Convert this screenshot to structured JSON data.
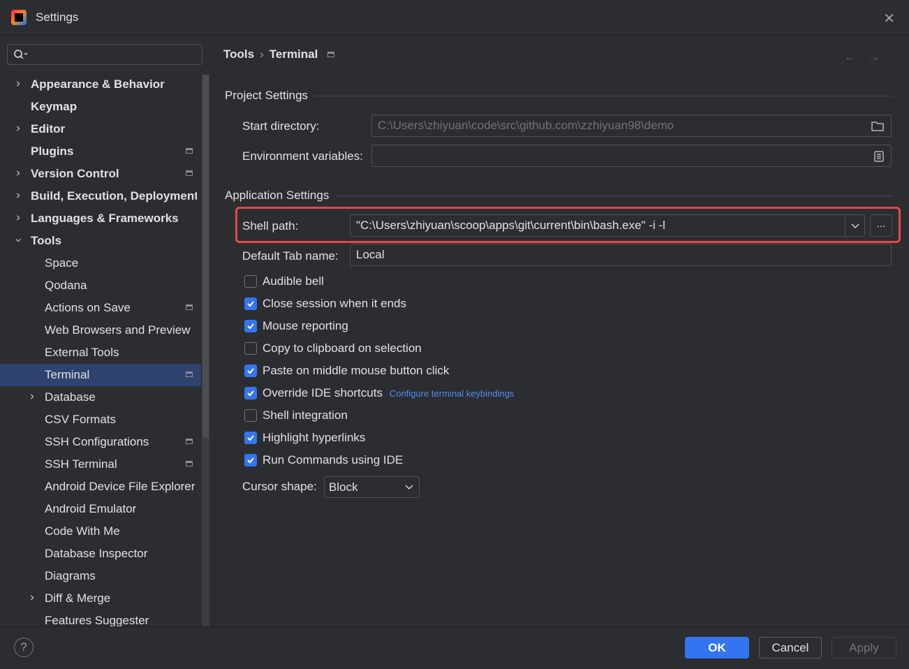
{
  "window": {
    "title": "Settings"
  },
  "search": {
    "placeholder": ""
  },
  "sidebar": {
    "items": [
      {
        "label": "Appearance & Behavior",
        "bold": true,
        "level": 0,
        "chevron": "right",
        "mark": false
      },
      {
        "label": "Keymap",
        "bold": true,
        "level": 0,
        "chevron": "none",
        "mark": false
      },
      {
        "label": "Editor",
        "bold": true,
        "level": 0,
        "chevron": "right",
        "mark": false
      },
      {
        "label": "Plugins",
        "bold": true,
        "level": 0,
        "chevron": "none",
        "mark": true
      },
      {
        "label": "Version Control",
        "bold": true,
        "level": 0,
        "chevron": "right",
        "mark": true
      },
      {
        "label": "Build, Execution, Deployment",
        "bold": true,
        "level": 0,
        "chevron": "right",
        "mark": false
      },
      {
        "label": "Languages & Frameworks",
        "bold": true,
        "level": 0,
        "chevron": "right",
        "mark": false
      },
      {
        "label": "Tools",
        "bold": true,
        "level": 0,
        "chevron": "down",
        "mark": false
      },
      {
        "label": "Space",
        "bold": false,
        "level": 1,
        "chevron": "none",
        "mark": false
      },
      {
        "label": "Qodana",
        "bold": false,
        "level": 1,
        "chevron": "none",
        "mark": false
      },
      {
        "label": "Actions on Save",
        "bold": false,
        "level": 1,
        "chevron": "none",
        "mark": true
      },
      {
        "label": "Web Browsers and Preview",
        "bold": false,
        "level": 1,
        "chevron": "none",
        "mark": false
      },
      {
        "label": "External Tools",
        "bold": false,
        "level": 1,
        "chevron": "none",
        "mark": false
      },
      {
        "label": "Terminal",
        "bold": false,
        "level": 1,
        "chevron": "none",
        "mark": true,
        "selected": true
      },
      {
        "label": "Database",
        "bold": false,
        "level": 1,
        "chevron": "right",
        "mark": false
      },
      {
        "label": "CSV Formats",
        "bold": false,
        "level": 1,
        "chevron": "none",
        "mark": false
      },
      {
        "label": "SSH Configurations",
        "bold": false,
        "level": 1,
        "chevron": "none",
        "mark": true
      },
      {
        "label": "SSH Terminal",
        "bold": false,
        "level": 1,
        "chevron": "none",
        "mark": true
      },
      {
        "label": "Android Device File Explorer",
        "bold": false,
        "level": 1,
        "chevron": "none",
        "mark": false
      },
      {
        "label": "Android Emulator",
        "bold": false,
        "level": 1,
        "chevron": "none",
        "mark": false
      },
      {
        "label": "Code With Me",
        "bold": false,
        "level": 1,
        "chevron": "none",
        "mark": false
      },
      {
        "label": "Database Inspector",
        "bold": false,
        "level": 1,
        "chevron": "none",
        "mark": false
      },
      {
        "label": "Diagrams",
        "bold": false,
        "level": 1,
        "chevron": "none",
        "mark": false
      },
      {
        "label": "Diff & Merge",
        "bold": false,
        "level": 1,
        "chevron": "right",
        "mark": false
      },
      {
        "label": "Features Suggester",
        "bold": false,
        "level": 1,
        "chevron": "none",
        "mark": false
      }
    ]
  },
  "breadcrumb": {
    "parent": "Tools",
    "separator": "›",
    "current": "Terminal"
  },
  "nav": {
    "back_icon": "arrow-left-icon",
    "forward_icon": "arrow-right-icon"
  },
  "project_settings": {
    "title": "Project Settings",
    "start_directory_label": "Start directory:",
    "start_directory_value": "C:\\Users\\zhiyuan\\code\\src\\github.com\\zzhiyuan98\\demo",
    "env_vars_label": "Environment variables:",
    "env_vars_value": ""
  },
  "application_settings": {
    "title": "Application Settings",
    "shell_path_label": "Shell path:",
    "shell_path_value": "\"C:\\Users\\zhiyuan\\scoop\\apps\\git\\current\\bin\\bash.exe\" -i -l",
    "browse_label": "...",
    "default_tab_label": "Default Tab name:",
    "default_tab_value": "Local",
    "checkboxes": [
      {
        "label": "Audible bell",
        "checked": false
      },
      {
        "label": "Close session when it ends",
        "checked": true
      },
      {
        "label": "Mouse reporting",
        "checked": true
      },
      {
        "label": "Copy to clipboard on selection",
        "checked": false
      },
      {
        "label": "Paste on middle mouse button click",
        "checked": true
      },
      {
        "label": "Override IDE shortcuts",
        "checked": true,
        "link": "Configure terminal keybindings"
      },
      {
        "label": "Shell integration",
        "checked": false
      },
      {
        "label": "Highlight hyperlinks",
        "checked": true
      },
      {
        "label": "Run Commands using IDE",
        "checked": true
      }
    ],
    "cursor_shape_label": "Cursor shape:",
    "cursor_shape_value": "Block"
  },
  "footer": {
    "help": "?",
    "ok": "OK",
    "cancel": "Cancel",
    "apply": "Apply"
  },
  "colors": {
    "accent": "#3574f0",
    "highlight": "#e5474b",
    "selection": "#2e436e",
    "link": "#548af7"
  }
}
